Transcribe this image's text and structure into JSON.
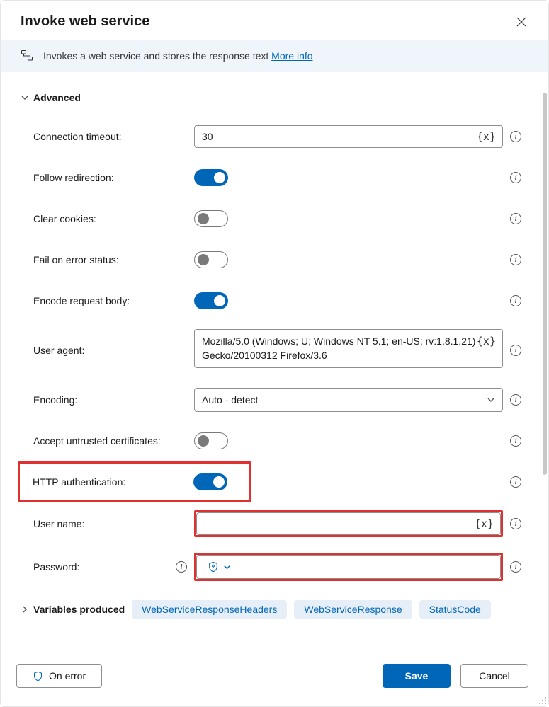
{
  "dialog": {
    "title": "Invoke web service",
    "description": "Invokes a web service and stores the response text",
    "more_info": "More info"
  },
  "section": {
    "advanced": "Advanced",
    "variables_produced": "Variables produced"
  },
  "labels": {
    "connection_timeout": "Connection timeout:",
    "follow_redirection": "Follow redirection:",
    "clear_cookies": "Clear cookies:",
    "fail_on_error_status": "Fail on error status:",
    "encode_request_body": "Encode request body:",
    "user_agent": "User agent:",
    "encoding": "Encoding:",
    "accept_untrusted": "Accept untrusted certificates:",
    "http_auth": "HTTP authentication:",
    "user_name": "User name:",
    "password": "Password:"
  },
  "values": {
    "connection_timeout": "30",
    "user_agent": "Mozilla/5.0 (Windows; U; Windows NT 5.1; en-US; rv:1.8.1.21) Gecko/20100312 Firefox/3.6",
    "encoding": "Auto - detect",
    "user_name": "",
    "password": ""
  },
  "toggles": {
    "follow_redirection": true,
    "clear_cookies": false,
    "fail_on_error_status": false,
    "encode_request_body": true,
    "accept_untrusted": false,
    "http_auth": true
  },
  "variables": {
    "items": [
      "WebServiceResponseHeaders",
      "WebServiceResponse",
      "StatusCode"
    ]
  },
  "footer": {
    "on_error": "On error",
    "save": "Save",
    "cancel": "Cancel"
  },
  "tokens": {
    "var": "{x}"
  }
}
